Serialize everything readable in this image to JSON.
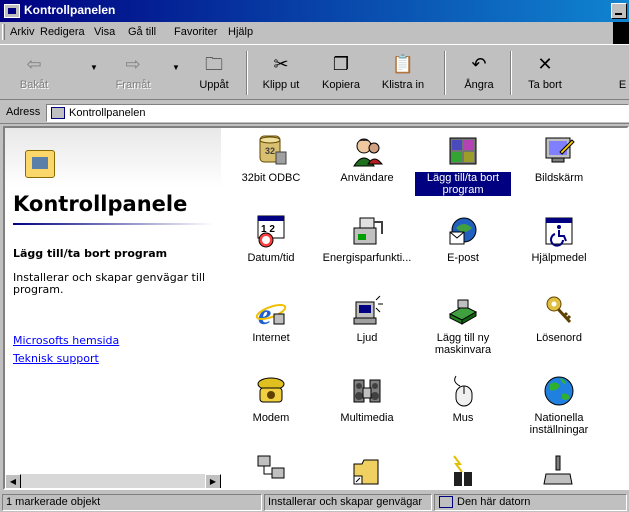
{
  "window": {
    "title": "Kontrollpanelen"
  },
  "menu": [
    "Arkiv",
    "Redigera",
    "Visa",
    "Gå till",
    "Favoriter",
    "Hjälp"
  ],
  "toolbar": {
    "back": "Bakåt",
    "forward": "Framåt",
    "up": "Uppåt",
    "cut": "Klipp ut",
    "copy": "Kopiera",
    "paste": "Klistra in",
    "undo": "Ångra",
    "delete": "Ta bort",
    "more": "E"
  },
  "address": {
    "label": "Adress",
    "value": "Kontrollpanelen"
  },
  "left_pane": {
    "title": "Kontrollpanele",
    "heading": "Lägg till/ta bort program",
    "description": "Installerar och skapar genvägar till program.",
    "links": [
      "Microsofts hemsida",
      "Teknisk support"
    ]
  },
  "items": [
    {
      "label": "32bit ODBC",
      "icon": "odbc-icon"
    },
    {
      "label": "Användare",
      "icon": "users-icon"
    },
    {
      "label": "Lägg till/ta bort program",
      "icon": "add-remove-programs-icon"
    },
    {
      "label": "Bildskärm",
      "icon": "display-icon"
    },
    {
      "label": "Datum/tid",
      "icon": "date-time-icon"
    },
    {
      "label": "Energisparfunkti...",
      "icon": "power-icon"
    },
    {
      "label": "E-post",
      "icon": "mail-icon"
    },
    {
      "label": "Hjälpmedel",
      "icon": "accessibility-icon"
    },
    {
      "label": "Internet",
      "icon": "internet-icon"
    },
    {
      "label": "Ljud",
      "icon": "sound-icon"
    },
    {
      "label": "Lägg till ny maskinvara",
      "icon": "add-hardware-icon"
    },
    {
      "label": "Lösenord",
      "icon": "passwords-icon"
    },
    {
      "label": "Modem",
      "icon": "modem-icon"
    },
    {
      "label": "Multimedia",
      "icon": "multimedia-icon"
    },
    {
      "label": "Mus",
      "icon": "mouse-icon"
    },
    {
      "label": "Nationella inställningar",
      "icon": "regional-settings-icon"
    },
    {
      "label": "",
      "icon": "network-icon"
    },
    {
      "label": "",
      "icon": "shortcut-folder-icon"
    },
    {
      "label": "",
      "icon": "find-fast-icon"
    },
    {
      "label": "",
      "icon": "game-controller-icon"
    }
  ],
  "selected_index": 2,
  "status": {
    "left": "1 markerade objekt",
    "middle": "Installerar och skapar genvägar",
    "right": "Den här datorn"
  }
}
